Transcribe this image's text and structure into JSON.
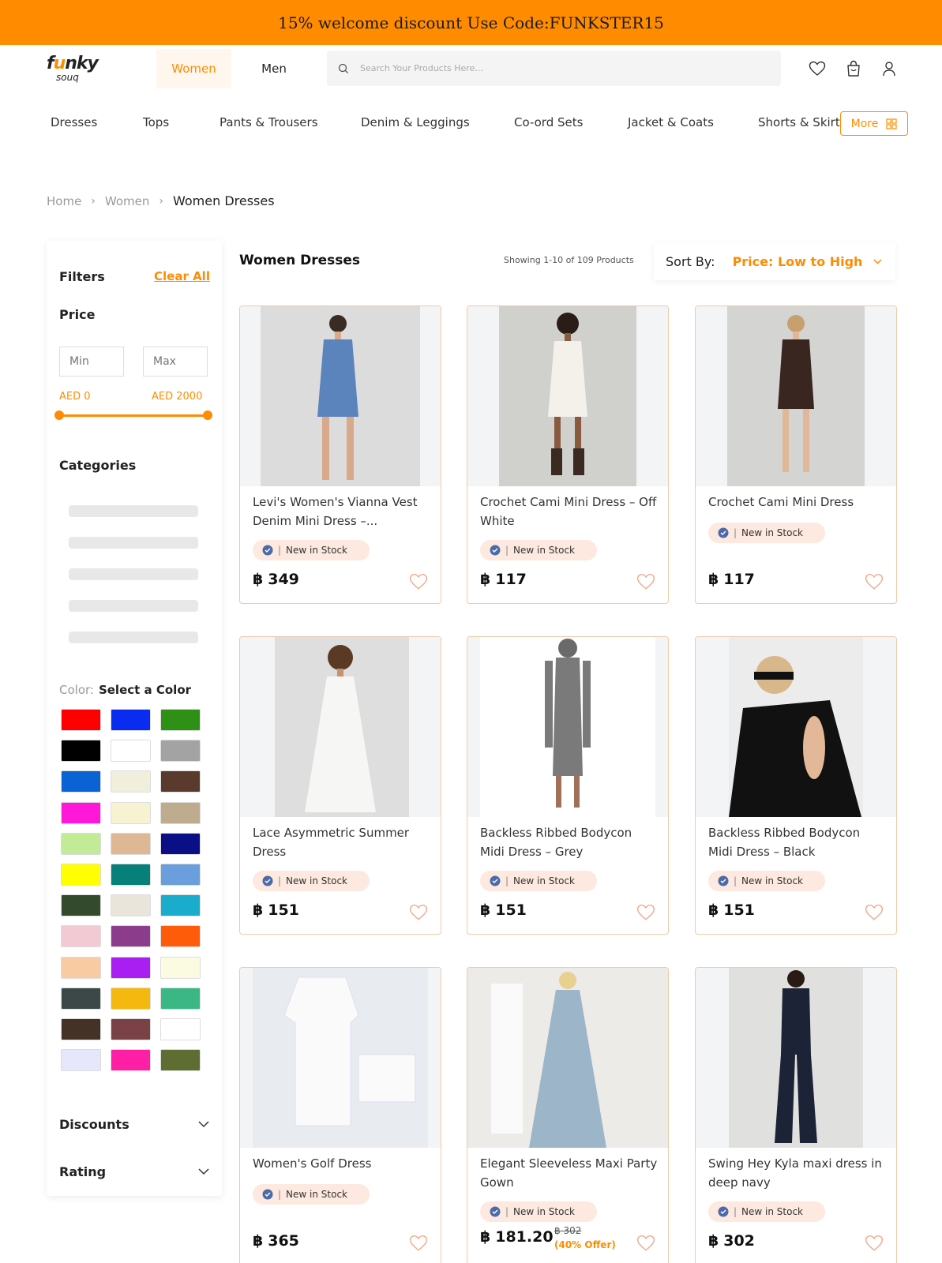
{
  "promo": {
    "text": "15% welcome discount Use Code:FUNKSTER15"
  },
  "brand": {
    "line1_a": "f",
    "line1_o": "u",
    "line1_b": "nky",
    "line2": "souq",
    "accent": "#ff8c00"
  },
  "gender_tabs": [
    {
      "label": "Women",
      "active": true
    },
    {
      "label": "Men",
      "active": false
    }
  ],
  "search": {
    "placeholder": "Search Your Products Here..."
  },
  "header_icons": [
    "heart-icon",
    "bag-icon",
    "user-icon"
  ],
  "categories": [
    "Dresses",
    "Tops",
    "Pants & Trousers",
    "Denim & Leggings",
    "Co-ord Sets",
    "Jacket & Coats",
    "Shorts & Skirt"
  ],
  "more_label": "More",
  "breadcrumb": {
    "home": "Home",
    "women": "Women",
    "current": "Women Dresses"
  },
  "filters": {
    "title": "Filters",
    "clear": "Clear All",
    "price_title": "Price",
    "min_placeholder": "Min",
    "max_placeholder": "Max",
    "min_label": "AED 0",
    "max_label": "AED 2000",
    "categories_title": "Categories",
    "color_key": "Color:",
    "color_value": "Select a Color",
    "colors": [
      "#ff0000",
      "#0a2cf0",
      "#2e9014",
      "#000000",
      "#ffffff",
      "#a3a3a3",
      "#0a63d4",
      "#efefdc",
      "#5a3a2c",
      "#ff18d8",
      "#f7f3d2",
      "#bfab8d",
      "#c2eb98",
      "#deb894",
      "#0a0f86",
      "#ffff00",
      "#08807a",
      "#6b9edc",
      "#344a2d",
      "#eae5da",
      "#1aaccc",
      "#f2cad4",
      "#8b3d8c",
      "#ff5c0a",
      "#f8cba3",
      "#a91ff2",
      "#fafbe0",
      "#3c4848",
      "#f4b80e",
      "#3bb785",
      "#443226",
      "#7a4146",
      "#ffffff",
      "#e7e7fb",
      "#ff1fa4",
      "#5e6e32"
    ],
    "discounts": "Discounts",
    "rating": "Rating"
  },
  "listing": {
    "title": "Women Dresses",
    "showing": "Showing 1-10 of 109 Products",
    "sort_key": "Sort By:",
    "sort_value": "Price: Low to High"
  },
  "badge_text": "New in Stock",
  "currency_symbol": "฿",
  "products": [
    {
      "title": "Levi's Women's Vianna Vest Denim Mini Dress –...",
      "price": "349"
    },
    {
      "title": "Crochet Cami Mini Dress – Off White",
      "price": "117"
    },
    {
      "title": "Crochet Cami Mini Dress",
      "price": "117"
    },
    {
      "title": "Lace Asymmetric Summer Dress",
      "price": "151"
    },
    {
      "title": "Backless Ribbed Bodycon Midi Dress – Grey",
      "price": "151"
    },
    {
      "title": "Backless Ribbed Bodycon Midi Dress – Black",
      "price": "151"
    },
    {
      "title": "Women's Golf Dress",
      "price": "365"
    },
    {
      "title": "Elegant Sleeveless Maxi Party Gown",
      "price": "181.20",
      "old_price": "302",
      "offer": "(40% Offer)"
    },
    {
      "title": "Swing Hey Kyla maxi dress in deep navy",
      "price": "302"
    }
  ]
}
